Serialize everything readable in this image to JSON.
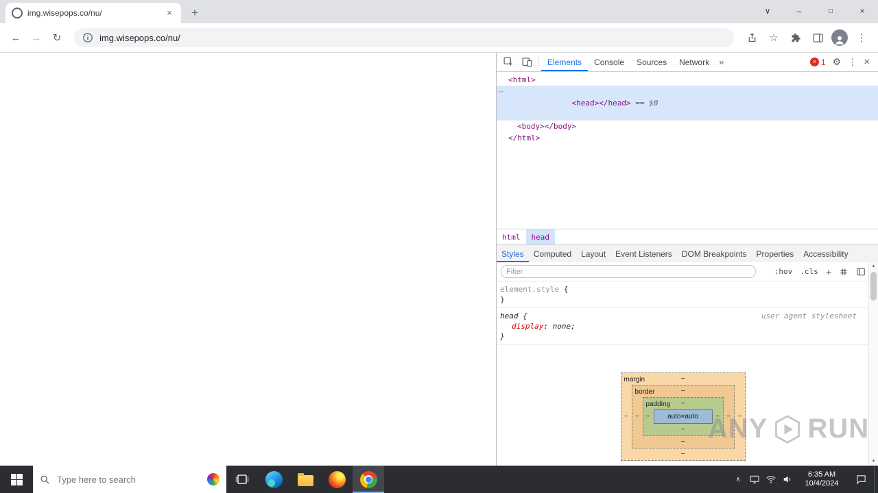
{
  "colors": {
    "accent_blue": "#1a73e8",
    "selection_blue": "#d7e6fb",
    "tag_maroon": "#881280",
    "css_property_red": "#c80000",
    "error_red": "#d93025",
    "box_margin": "#fad7a7",
    "box_border": "#f0c891",
    "box_padding": "#b7cb8f",
    "box_content": "#9cbcd8",
    "taskbar_bg": "#2b2d31"
  },
  "icons": {
    "close": "×",
    "plus": "+",
    "chevron_down": "∨",
    "minimize": "–",
    "maximize": "□",
    "back": "←",
    "forward": "→",
    "reload": "↻",
    "star": "☆",
    "kebab": "⋮",
    "more_tabs": "»",
    "gear": "⚙",
    "error_x": "×",
    "dom_more": "⋯",
    "tray_chevron": "∧",
    "scroll_up": "▲",
    "scroll_down": "▼"
  },
  "window": {
    "tab_title": "img.wisepops.co/nu/",
    "url": "img.wisepops.co/nu/"
  },
  "devtools": {
    "panel_tabs": [
      "Elements",
      "Console",
      "Sources",
      "Network"
    ],
    "error_count": "1",
    "dom": {
      "open_html": "<html>",
      "head_line": "<head></head>",
      "head_eq": " == $0",
      "body_line": "<body></body>",
      "close_html": "</html>"
    },
    "breadcrumbs": [
      "html",
      "head"
    ],
    "sidebar_tabs": [
      "Styles",
      "Computed",
      "Layout",
      "Event Listeners",
      "DOM Breakpoints",
      "Properties",
      "Accessibility"
    ],
    "filter": {
      "placeholder": "Filter",
      "hov": ":hov",
      "cls": ".cls",
      "new_rule": "+"
    },
    "rules": [
      {
        "selector": "element.style",
        "open": "{",
        "close": "}"
      },
      {
        "selector": "head",
        "open": "{",
        "property": "display",
        "colon": ": ",
        "value": "none;",
        "close": "}",
        "origin": "user agent stylesheet"
      }
    ],
    "box_model": {
      "margin_label": "margin",
      "border_label": "border",
      "padding_label": "padding",
      "content_label": "auto×auto",
      "dash": "−"
    }
  },
  "watermark": {
    "any": "ANY",
    "run": "RUN"
  },
  "taskbar": {
    "search_placeholder": "Type here to search",
    "clock_time": "6:35 AM",
    "clock_date": "10/4/2024"
  }
}
